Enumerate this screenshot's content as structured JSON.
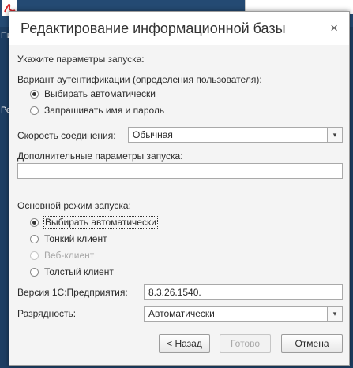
{
  "background": {
    "label_top": "Пи",
    "label_mid": "Ре"
  },
  "dialog": {
    "title": "Редактирование информационной базы",
    "close_glyph": "×",
    "launch_params_label": "Укажите параметры запуска:",
    "auth": {
      "label": "Вариант аутентификации (определения пользователя):",
      "options": [
        {
          "label": "Выбирать автоматически",
          "selected": true
        },
        {
          "label": "Запрашивать имя и пароль",
          "selected": false
        }
      ]
    },
    "speed": {
      "label": "Скорость соединения:",
      "value": "Обычная",
      "dropdown_glyph": "▾"
    },
    "extra_params": {
      "label": "Дополнительные параметры запуска:",
      "value": ""
    },
    "mode": {
      "label": "Основной режим запуска:",
      "options": [
        {
          "label": "Выбирать автоматически",
          "selected": true,
          "disabled": false
        },
        {
          "label": "Тонкий клиент",
          "selected": false,
          "disabled": false
        },
        {
          "label": "Веб-клиент",
          "selected": false,
          "disabled": true
        },
        {
          "label": "Толстый клиент",
          "selected": false,
          "disabled": false
        }
      ]
    },
    "version": {
      "label": "Версия 1С:Предприятия:",
      "value": "8.3.26.1540."
    },
    "bitness": {
      "label": "Разрядность:",
      "value": "Автоматически",
      "dropdown_glyph": "▾"
    },
    "buttons": {
      "back": "< Назад",
      "finish": "Готово",
      "cancel": "Отмена"
    }
  }
}
